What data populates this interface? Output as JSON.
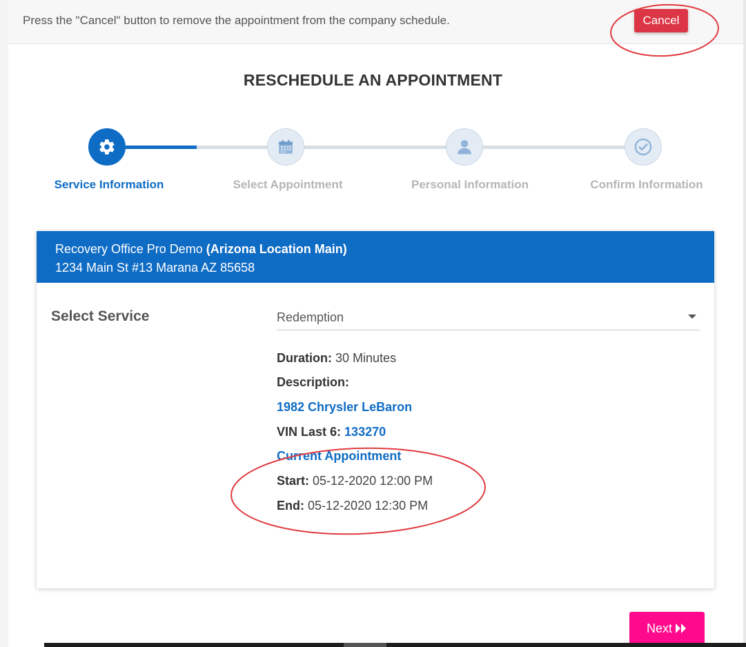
{
  "notice": {
    "text": "Press the \"Cancel\" button to remove the appointment from the company schedule.",
    "cancel_label": "Cancel"
  },
  "page_title": "RESCHEDULE AN APPOINTMENT",
  "steps": [
    {
      "label": "Service Information",
      "icon": "gear-icon",
      "active": true
    },
    {
      "label": "Select Appointment",
      "icon": "calendar-icon",
      "active": false
    },
    {
      "label": "Personal Information",
      "icon": "user-icon",
      "active": false
    },
    {
      "label": "Confirm Information",
      "icon": "check-circle-icon",
      "active": false
    }
  ],
  "location": {
    "company": "Recovery Office Pro Demo",
    "location_name": "(Arizona Location Main)",
    "address": "1234 Main St #13 Marana AZ 85658"
  },
  "service": {
    "label": "Select Service",
    "selected": "Redemption",
    "duration_label": "Duration:",
    "duration_value": "30 Minutes",
    "description_label": "Description:",
    "vehicle": "1982 Chrysler LeBaron",
    "vin_label": "VIN Last 6:",
    "vin_value": "133270",
    "current_appointment_label": "Current Appointment",
    "start_label": "Start:",
    "start_value": "05-12-2020 12:00 PM",
    "end_label": "End:",
    "end_value": "05-12-2020 12:30 PM"
  },
  "next_label": "Next",
  "colors": {
    "primary": "#0f6cc5",
    "cancel": "#dc3545",
    "next": "#ff0a8c",
    "annotation": "#e0393e"
  }
}
